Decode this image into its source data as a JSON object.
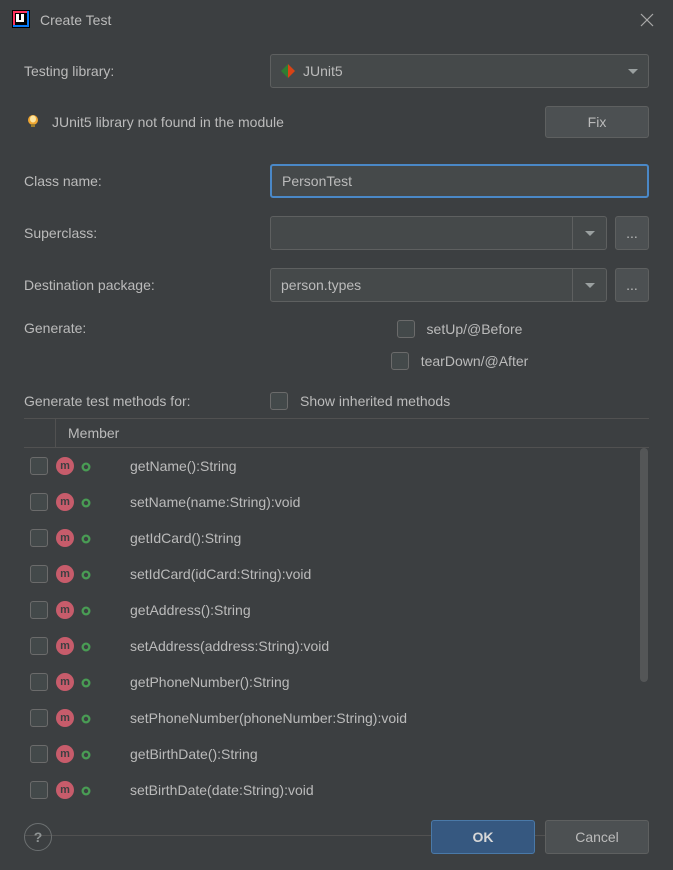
{
  "title": "Create Test",
  "labels": {
    "testing_library": "Testing library:",
    "class_name": "Class name:",
    "superclass": "Superclass:",
    "destination_package": "Destination package:",
    "generate": "Generate:",
    "generate_methods": "Generate test methods for:",
    "member_header": "Member"
  },
  "library": {
    "selected": "JUnit5"
  },
  "warning": {
    "text": "JUnit5 library not found in the module",
    "fix_label": "Fix"
  },
  "fields": {
    "class_name_value": "PersonTest",
    "superclass_value": "",
    "destination_package_value": "person.types"
  },
  "generate": {
    "setup": "setUp/@Before",
    "teardown": "tearDown/@After",
    "show_inherited": "Show inherited methods"
  },
  "members": [
    {
      "name": "getName():String"
    },
    {
      "name": "setName(name:String):void"
    },
    {
      "name": "getIdCard():String"
    },
    {
      "name": "setIdCard(idCard:String):void"
    },
    {
      "name": "getAddress():String"
    },
    {
      "name": "setAddress(address:String):void"
    },
    {
      "name": "getPhoneNumber():String"
    },
    {
      "name": "setPhoneNumber(phoneNumber:String):void"
    },
    {
      "name": "getBirthDate():String"
    },
    {
      "name": "setBirthDate(date:String):void"
    }
  ],
  "buttons": {
    "ok": "OK",
    "cancel": "Cancel",
    "browse": "...",
    "help": "?"
  }
}
